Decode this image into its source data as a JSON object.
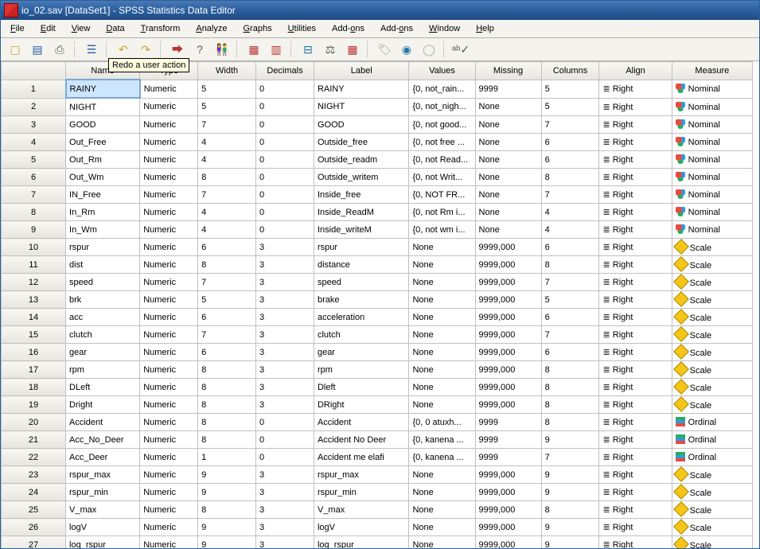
{
  "window": {
    "title": "io_02.sav [DataSet1] - SPSS Statistics Data Editor"
  },
  "menu": [
    "File",
    "Edit",
    "View",
    "Data",
    "Transform",
    "Analyze",
    "Graphs",
    "Utilities",
    "Add-ons",
    "Add-ons",
    "Window",
    "Help"
  ],
  "tooltip": "Redo a user action",
  "columns": {
    "row": "",
    "name": "Name",
    "type": "Type",
    "width": "Width",
    "decimals": "Decimals",
    "label": "Label",
    "values": "Values",
    "missing": "Missing",
    "cols": "Columns",
    "align": "Align",
    "measure": "Measure"
  },
  "align_label": "Right",
  "measure_labels": {
    "nominal": "Nominal",
    "scale": "Scale",
    "ordinal": "Ordinal"
  },
  "rows": [
    {
      "n": 1,
      "name": "RAINY",
      "type": "Numeric",
      "width": "5",
      "dec": "0",
      "label": "RAINY",
      "values": "{0, not_rain...",
      "missing": "9999",
      "cols": "5",
      "align": "Right",
      "measure": "nominal"
    },
    {
      "n": 2,
      "name": "NIGHT",
      "type": "Numeric",
      "width": "5",
      "dec": "0",
      "label": "NIGHT",
      "values": "{0, not_nigh...",
      "missing": "None",
      "cols": "5",
      "align": "Right",
      "measure": "nominal"
    },
    {
      "n": 3,
      "name": "GOOD",
      "type": "Numeric",
      "width": "7",
      "dec": "0",
      "label": "GOOD",
      "values": "{0, not good...",
      "missing": "None",
      "cols": "7",
      "align": "Right",
      "measure": "nominal"
    },
    {
      "n": 4,
      "name": "Out_Free",
      "type": "Numeric",
      "width": "4",
      "dec": "0",
      "label": "Outside_free",
      "values": "{0, not free ...",
      "missing": "None",
      "cols": "6",
      "align": "Right",
      "measure": "nominal"
    },
    {
      "n": 5,
      "name": "Out_Rm",
      "type": "Numeric",
      "width": "4",
      "dec": "0",
      "label": "Outside_readm",
      "values": "{0, not Read...",
      "missing": "None",
      "cols": "6",
      "align": "Right",
      "measure": "nominal"
    },
    {
      "n": 6,
      "name": "Out_Wm",
      "type": "Numeric",
      "width": "8",
      "dec": "0",
      "label": "Outside_writem",
      "values": "{0, not Writ...",
      "missing": "None",
      "cols": "8",
      "align": "Right",
      "measure": "nominal"
    },
    {
      "n": 7,
      "name": "IN_Free",
      "type": "Numeric",
      "width": "7",
      "dec": "0",
      "label": "Inside_free",
      "values": "{0, NOT FR...",
      "missing": "None",
      "cols": "7",
      "align": "Right",
      "measure": "nominal"
    },
    {
      "n": 8,
      "name": "In_Rm",
      "type": "Numeric",
      "width": "4",
      "dec": "0",
      "label": "Inside_ReadM",
      "values": "{0, not Rm i...",
      "missing": "None",
      "cols": "4",
      "align": "Right",
      "measure": "nominal"
    },
    {
      "n": 9,
      "name": "In_Wm",
      "type": "Numeric",
      "width": "4",
      "dec": "0",
      "label": "Inside_writeM",
      "values": "{0, not wm i...",
      "missing": "None",
      "cols": "4",
      "align": "Right",
      "measure": "nominal"
    },
    {
      "n": 10,
      "name": "rspur",
      "type": "Numeric",
      "width": "6",
      "dec": "3",
      "label": "rspur",
      "values": "None",
      "missing": "9999,000",
      "cols": "6",
      "align": "Right",
      "measure": "scale"
    },
    {
      "n": 11,
      "name": "dist",
      "type": "Numeric",
      "width": "8",
      "dec": "3",
      "label": "distance",
      "values": "None",
      "missing": "9999,000",
      "cols": "8",
      "align": "Right",
      "measure": "scale"
    },
    {
      "n": 12,
      "name": "speed",
      "type": "Numeric",
      "width": "7",
      "dec": "3",
      "label": "speed",
      "values": "None",
      "missing": "9999,000",
      "cols": "7",
      "align": "Right",
      "measure": "scale"
    },
    {
      "n": 13,
      "name": "brk",
      "type": "Numeric",
      "width": "5",
      "dec": "3",
      "label": "brake",
      "values": "None",
      "missing": "9999,000",
      "cols": "5",
      "align": "Right",
      "measure": "scale"
    },
    {
      "n": 14,
      "name": "acc",
      "type": "Numeric",
      "width": "6",
      "dec": "3",
      "label": "acceleration",
      "values": "None",
      "missing": "9999,000",
      "cols": "6",
      "align": "Right",
      "measure": "scale"
    },
    {
      "n": 15,
      "name": "clutch",
      "type": "Numeric",
      "width": "7",
      "dec": "3",
      "label": "clutch",
      "values": "None",
      "missing": "9999,000",
      "cols": "7",
      "align": "Right",
      "measure": "scale"
    },
    {
      "n": 16,
      "name": "gear",
      "type": "Numeric",
      "width": "6",
      "dec": "3",
      "label": "gear",
      "values": "None",
      "missing": "9999,000",
      "cols": "6",
      "align": "Right",
      "measure": "scale"
    },
    {
      "n": 17,
      "name": "rpm",
      "type": "Numeric",
      "width": "8",
      "dec": "3",
      "label": "rpm",
      "values": "None",
      "missing": "9999,000",
      "cols": "8",
      "align": "Right",
      "measure": "scale"
    },
    {
      "n": 18,
      "name": "DLeft",
      "type": "Numeric",
      "width": "8",
      "dec": "3",
      "label": "Dleft",
      "values": "None",
      "missing": "9999,000",
      "cols": "8",
      "align": "Right",
      "measure": "scale"
    },
    {
      "n": 19,
      "name": "Dright",
      "type": "Numeric",
      "width": "8",
      "dec": "3",
      "label": "DRight",
      "values": "None",
      "missing": "9999,000",
      "cols": "8",
      "align": "Right",
      "measure": "scale"
    },
    {
      "n": 20,
      "name": "Accident",
      "type": "Numeric",
      "width": "8",
      "dec": "0",
      "label": "Accident",
      "values": "{0, 0 atuxh...",
      "missing": "9999",
      "cols": "8",
      "align": "Right",
      "measure": "ordinal"
    },
    {
      "n": 21,
      "name": "Acc_No_Deer",
      "type": "Numeric",
      "width": "8",
      "dec": "0",
      "label": "Accident No Deer",
      "values": "{0, kanena ...",
      "missing": "9999",
      "cols": "9",
      "align": "Right",
      "measure": "ordinal"
    },
    {
      "n": 22,
      "name": "Acc_Deer",
      "type": "Numeric",
      "width": "1",
      "dec": "0",
      "label": "Accident me elafi",
      "values": "{0, kanena ...",
      "missing": "9999",
      "cols": "7",
      "align": "Right",
      "measure": "ordinal"
    },
    {
      "n": 23,
      "name": "rspur_max",
      "type": "Numeric",
      "width": "9",
      "dec": "3",
      "label": "rspur_max",
      "values": "None",
      "missing": "9999,000",
      "cols": "9",
      "align": "Right",
      "measure": "scale"
    },
    {
      "n": 24,
      "name": "rspur_min",
      "type": "Numeric",
      "width": "9",
      "dec": "3",
      "label": "rspur_min",
      "values": "None",
      "missing": "9999,000",
      "cols": "9",
      "align": "Right",
      "measure": "scale"
    },
    {
      "n": 25,
      "name": "V_max",
      "type": "Numeric",
      "width": "8",
      "dec": "3",
      "label": "V_max",
      "values": "None",
      "missing": "9999,000",
      "cols": "8",
      "align": "Right",
      "measure": "scale"
    },
    {
      "n": 26,
      "name": "logV",
      "type": "Numeric",
      "width": "9",
      "dec": "3",
      "label": "logV",
      "values": "None",
      "missing": "9999,000",
      "cols": "9",
      "align": "Right",
      "measure": "scale"
    },
    {
      "n": 27,
      "name": "log_rspur",
      "type": "Numeric",
      "width": "9",
      "dec": "3",
      "label": "log_rspur",
      "values": "None",
      "missing": "9999,000",
      "cols": "9",
      "align": "Right",
      "measure": "scale"
    }
  ]
}
